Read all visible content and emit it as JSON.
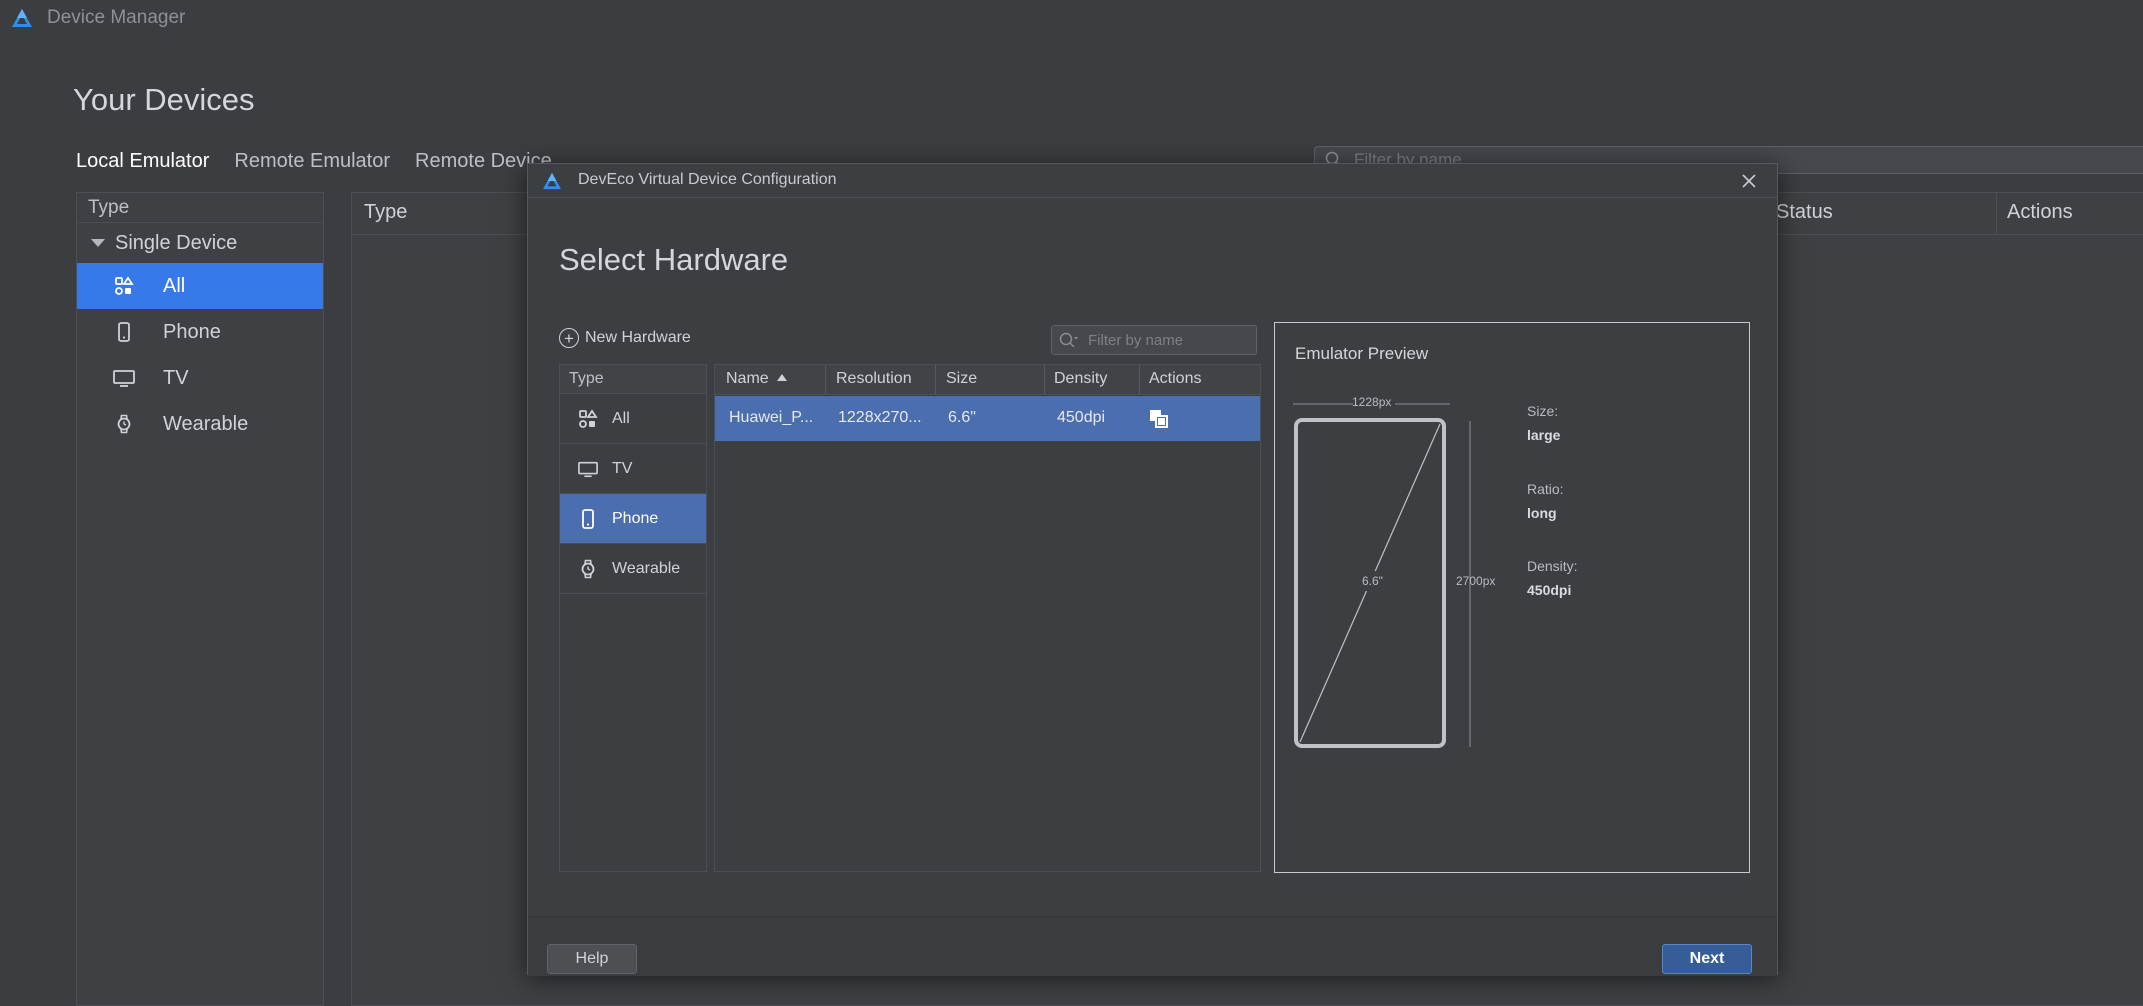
{
  "app": {
    "title": "Device Manager",
    "logo_icon": "deveco-logo-icon"
  },
  "page": {
    "heading": "Your Devices",
    "tabs": [
      {
        "label": "Local Emulator",
        "active": true
      },
      {
        "label": "Remote Emulator",
        "active": false
      },
      {
        "label": "Remote Device",
        "active": false
      }
    ],
    "filter_placeholder": "Filter by name"
  },
  "sidebar": {
    "header": "Type",
    "group": "Single Device",
    "items": [
      {
        "label": "All",
        "icon": "all-categories-icon",
        "active": true
      },
      {
        "label": "Phone",
        "icon": "phone-icon",
        "active": false
      },
      {
        "label": "TV",
        "icon": "tv-icon",
        "active": false
      },
      {
        "label": "Wearable",
        "icon": "watch-icon",
        "active": false
      }
    ]
  },
  "device_table": {
    "columns": [
      "Type",
      "Status",
      "Actions"
    ]
  },
  "dialog": {
    "title": "DevEco Virtual Device Configuration",
    "heading": "Select Hardware",
    "new_hardware_label": "New Hardware",
    "filter_placeholder": "Filter by name",
    "type_panel": {
      "header": "Type",
      "items": [
        {
          "label": "All",
          "icon": "all-categories-icon",
          "active": false
        },
        {
          "label": "TV",
          "icon": "tv-icon",
          "active": false
        },
        {
          "label": "Phone",
          "icon": "phone-icon",
          "active": true
        },
        {
          "label": "Wearable",
          "icon": "watch-icon",
          "active": false
        }
      ]
    },
    "hardware_table": {
      "columns": [
        "Name",
        "Resolution",
        "Size",
        "Density",
        "Actions"
      ],
      "sort_column": "Name",
      "sort_direction": "ascending",
      "rows": [
        {
          "name": "Huawei_P...",
          "resolution": "1228x270...",
          "size": "6.6\"",
          "density": "450dpi",
          "action_icon": "clone-icon",
          "selected": true
        }
      ]
    },
    "preview": {
      "title": "Emulator Preview",
      "width_label": "1228px",
      "height_label": "2700px",
      "diagonal_label": "6.6\"",
      "specs": [
        {
          "label": "Size:",
          "value": "large"
        },
        {
          "label": "Ratio:",
          "value": "long"
        },
        {
          "label": "Density:",
          "value": "450dpi"
        }
      ]
    },
    "buttons": {
      "help": "Help",
      "next": "Next"
    },
    "colors": {
      "selection": "#4b6eaf",
      "accent": "#3779e8"
    }
  }
}
